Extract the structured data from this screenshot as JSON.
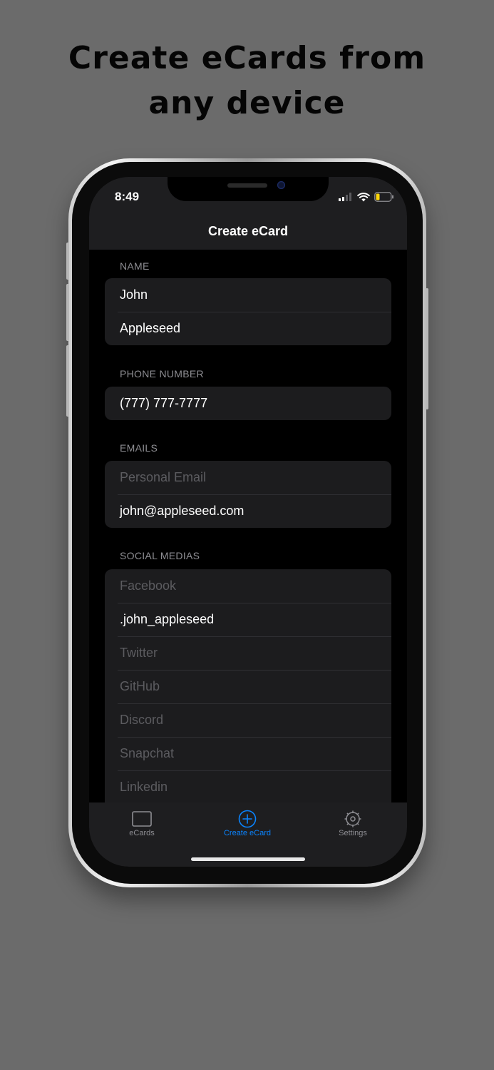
{
  "headline": {
    "line1": "Create eCards from",
    "line2": "any device"
  },
  "status_bar": {
    "time": "8:49",
    "icons": [
      "signal-icon",
      "wifi-icon",
      "battery-icon"
    ]
  },
  "nav": {
    "title": "Create eCard"
  },
  "sections": {
    "name": {
      "header": "NAME",
      "fields": [
        {
          "value": "John",
          "placeholder": ""
        },
        {
          "value": "Appleseed",
          "placeholder": ""
        }
      ]
    },
    "phone": {
      "header": "PHONE NUMBER",
      "fields": [
        {
          "value": "(777) 777-7777",
          "placeholder": ""
        }
      ]
    },
    "emails": {
      "header": "EMAILS",
      "fields": [
        {
          "value": "",
          "placeholder": "Personal Email"
        },
        {
          "value": "john@appleseed.com",
          "placeholder": ""
        }
      ]
    },
    "social": {
      "header": "SOCIAL MEDIAS",
      "fields": [
        {
          "value": "",
          "placeholder": "Facebook"
        },
        {
          "value": ".john_appleseed",
          "placeholder": ""
        },
        {
          "value": "",
          "placeholder": "Twitter"
        },
        {
          "value": "",
          "placeholder": "GitHub"
        },
        {
          "value": "",
          "placeholder": "Discord"
        },
        {
          "value": "",
          "placeholder": "Snapchat"
        },
        {
          "value": "",
          "placeholder": "Linkedin"
        }
      ]
    }
  },
  "tabbar": {
    "tabs": [
      {
        "label": "eCards",
        "icon": "card-icon",
        "active": false
      },
      {
        "label": "Create eCard",
        "icon": "plus-circle-icon",
        "active": true
      },
      {
        "label": "Settings",
        "icon": "gear-icon",
        "active": false
      }
    ]
  },
  "colors": {
    "background": "#6b6b6b",
    "screen": "#000000",
    "cell": "#1c1c1e",
    "accent": "#0a84ff",
    "placeholder": "#5c5c60",
    "section_header": "#8e8e93",
    "battery_level": "#ffd60a"
  }
}
